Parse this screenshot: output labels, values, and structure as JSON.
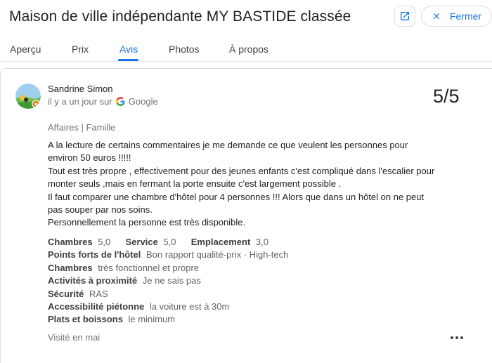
{
  "header": {
    "title": "Maison de ville indépendante MY BASTIDE classée",
    "close_label": "Fermer",
    "open_icon": "open-in-new-icon",
    "close_icon": "close-icon"
  },
  "tabs": [
    {
      "label": "Aperçu",
      "active": false
    },
    {
      "label": "Prix",
      "active": false
    },
    {
      "label": "Avis",
      "active": true
    },
    {
      "label": "Photos",
      "active": false
    },
    {
      "label": "À propos",
      "active": false
    }
  ],
  "review": {
    "author": "Sandrine Simon",
    "time_source": "il y a un jour sur",
    "source": "Google",
    "score": "5/5",
    "tags": "Affaires | Famille",
    "text_lines": [
      "A la lecture de certains commentaires je me demande ce que veulent les personnes pour",
      "environ 50 euros !!!!!",
      "Tout est très propre , effectivement pour des jeunes enfants c'est compliqué dans l'escalier pour",
      "monter seuls ,mais en fermant la porte ensuite c'est largement possible .",
      "Il faut comparer une chambre d'hôtel pour 4 personnes !!! Alors que dans un hôtel on ne peut",
      "pas souper par nos soins.",
      "Personnellement la personne est très disponible."
    ],
    "ratings": [
      {
        "label": "Chambres",
        "value": "5,0"
      },
      {
        "label": "Service",
        "value": "5,0"
      },
      {
        "label": "Emplacement",
        "value": "3,0"
      }
    ],
    "details": [
      {
        "label": "Points forts de l'hôtel",
        "value": "Bon rapport qualité-prix · High-tech"
      },
      {
        "label": "Chambres",
        "value": "très fonctionnel et propre"
      },
      {
        "label": "Activités à proximité",
        "value": "Je ne sais pas"
      },
      {
        "label": "Sécurité",
        "value": "RAS"
      },
      {
        "label": "Accessibilité piétonne",
        "value": "la voiture est à 30m"
      },
      {
        "label": "Plats et boissons",
        "value": "le minimum"
      }
    ],
    "visited": "Visité en mai",
    "more_icon": "more-horizontal-icon"
  },
  "colors": {
    "accent": "#1a73e8",
    "text": "#202124",
    "secondary": "#70757a"
  }
}
